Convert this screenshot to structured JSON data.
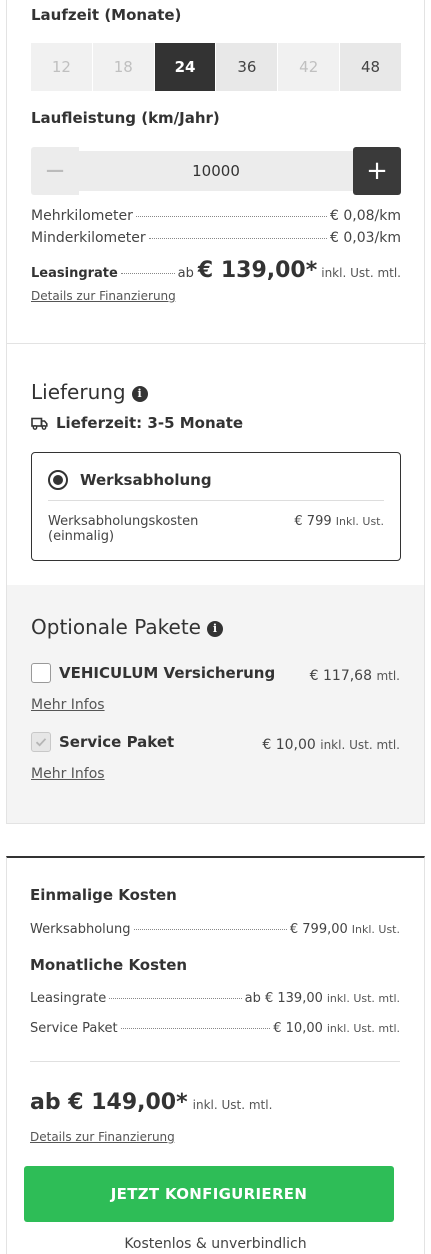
{
  "term": {
    "label": "Laufzeit (Monate)",
    "options": [
      {
        "value": "12",
        "state": "disabled"
      },
      {
        "value": "18",
        "state": "disabled"
      },
      {
        "value": "24",
        "state": "selected"
      },
      {
        "value": "36",
        "state": "normal"
      },
      {
        "value": "42",
        "state": "disabled"
      },
      {
        "value": "48",
        "state": "normal"
      }
    ]
  },
  "mileage": {
    "label": "Laufleistung (km/Jahr)",
    "value": "10000",
    "minus": "−",
    "plus": "+"
  },
  "rates": {
    "extra_km_label": "Mehrkilometer",
    "extra_km_value": "€ 0,08/km",
    "less_km_label": "Minderkilometer",
    "less_km_value": "€ 0,03/km",
    "leasing_label": "Leasingrate",
    "leasing_prefix": "ab",
    "leasing_price": "€ 139,00*",
    "leasing_suffix": "inkl. Ust. mtl.",
    "details_link": "Details zur Finanzierung"
  },
  "delivery": {
    "title": "Lieferung",
    "info_icon": "i",
    "time_text": "Lieferzeit: 3-5 Monate",
    "option_label": "Werksabholung",
    "cost_label_line1": "Werksabholungskosten",
    "cost_label_line2": "(einmalig)",
    "cost_value": "€ 799",
    "cost_suffix": "Inkl. Ust."
  },
  "packages": {
    "title": "Optionale Pakete",
    "info_icon": "i",
    "items": [
      {
        "name": "VEHICULUM Versicherung",
        "price": "€ 117,68",
        "suffix": "mtl.",
        "more": "Mehr Infos",
        "checked": false
      },
      {
        "name": "Service Paket",
        "price": "€ 10,00",
        "suffix": "inkl. Ust. mtl.",
        "more": "Mehr Infos",
        "checked": true
      }
    ]
  },
  "summary": {
    "one_time_title": "Einmalige Kosten",
    "pickup_label": "Werksabholung",
    "pickup_value": "€ 799,00",
    "pickup_suffix": "Inkl. Ust.",
    "monthly_title": "Monatliche Kosten",
    "leasing_label": "Leasingrate",
    "leasing_value": "ab € 139,00",
    "leasing_suffix": "inkl. Ust. mtl.",
    "service_label": "Service Paket",
    "service_value": "€ 10,00",
    "service_suffix": "inkl. Ust. mtl.",
    "total": "ab € 149,00*",
    "total_suffix": "inkl. Ust. mtl.",
    "details_link": "Details zur Finanzierung",
    "cta": "JETZT KONFIGURIEREN",
    "note": "Kostenlos & unverbindlich"
  },
  "colors": {
    "dark": "#333333",
    "cta_green": "#2ebd57",
    "panel_grey": "#f4f4f4"
  }
}
